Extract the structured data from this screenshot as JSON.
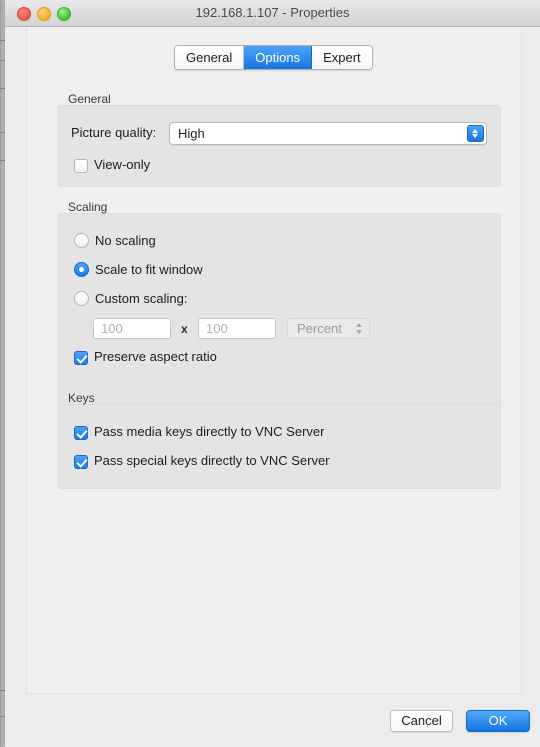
{
  "window": {
    "title": "192.168.1.107 - Properties",
    "traffic_lights": [
      {
        "name": "close",
        "color": "#f0574c"
      },
      {
        "name": "minimize",
        "color": "#f5b02a"
      },
      {
        "name": "maximize",
        "color": "#3ec234"
      }
    ]
  },
  "tabs": [
    {
      "label": "General",
      "selected": false
    },
    {
      "label": "Options",
      "selected": true
    },
    {
      "label": "Expert",
      "selected": false
    }
  ],
  "groups": {
    "general": {
      "label": "General",
      "picture_quality": {
        "label": "Picture quality:",
        "value": "High",
        "stepper_icon": "stepper-up-down-icon"
      },
      "view_only": {
        "label": "View-only",
        "checked": false
      }
    },
    "scaling": {
      "label": "Scaling",
      "options": [
        {
          "label": "No scaling",
          "selected": false
        },
        {
          "label": "Scale to fit window",
          "selected": true
        },
        {
          "label": "Custom scaling:",
          "selected": false
        }
      ],
      "custom_width": {
        "placeholder": "100",
        "value": "",
        "enabled": false
      },
      "custom_height": {
        "placeholder": "100",
        "value": "",
        "enabled": false
      },
      "separator": "x",
      "unit": {
        "value": "Percent",
        "enabled": false
      },
      "preserve_aspect_ratio": {
        "label": "Preserve aspect ratio",
        "checked": true
      }
    },
    "keys": {
      "label": "Keys",
      "items": [
        {
          "label": "Pass media keys directly to VNC Server",
          "checked": true
        },
        {
          "label": "Pass special keys directly to VNC Server",
          "checked": true
        }
      ]
    }
  },
  "footer": {
    "cancel_label": "Cancel",
    "ok_label": "OK"
  },
  "colors": {
    "accent": "#1775e0",
    "window_bg": "#ececec",
    "group_bg": "#e4e4e4"
  }
}
